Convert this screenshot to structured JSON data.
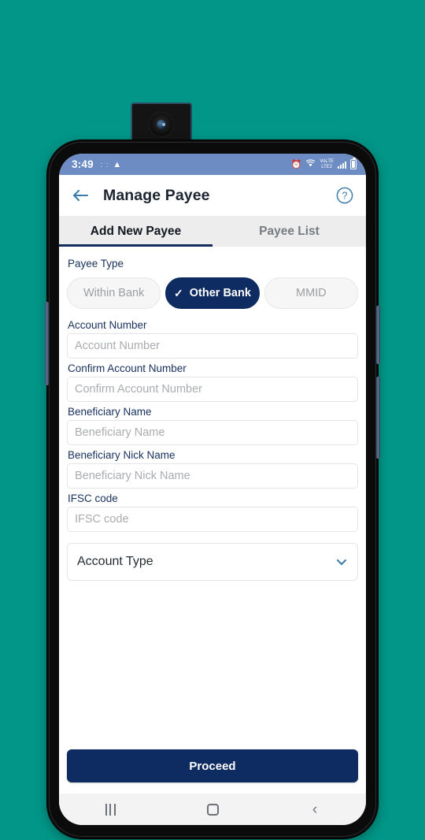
{
  "wallpaper": {
    "color": "#019687"
  },
  "device": {
    "frame_color": "#0b0b0c",
    "popup_camera": "popup-selfie-camera"
  },
  "statusbar": {
    "time": "3:49",
    "dots": ":  :",
    "warning_icon": "warning-triangle-icon",
    "alarm_icon": "alarm-clock-icon",
    "wifi_icon": "wifi-icon",
    "volte_label": "VoLTE",
    "lte_label": "LTE2",
    "signal_icon": "signal-bars-icon",
    "battery_icon": "battery-full-icon",
    "bg_color": "#6d8cc4"
  },
  "appbar": {
    "back_icon": "arrow-left-icon",
    "title": "Manage Payee",
    "help_icon": "help-circle-icon",
    "accent_color": "#3d7ca8"
  },
  "tabs": [
    {
      "label": "Add New Payee",
      "active": true
    },
    {
      "label": "Payee List",
      "active": false
    }
  ],
  "form": {
    "payee_type_label": "Payee Type",
    "payee_type_options": [
      {
        "label": "Within Bank",
        "selected": false
      },
      {
        "label": "Other Bank",
        "selected": true,
        "check_icon": "check-icon"
      },
      {
        "label": "MMID",
        "selected": false
      }
    ],
    "selected_color": "#0e2c61",
    "fields": [
      {
        "label": "Account Number",
        "placeholder": "Account Number",
        "value": ""
      },
      {
        "label": "Confirm Account Number",
        "placeholder": "Confirm Account Number",
        "value": ""
      },
      {
        "label": "Beneficiary Name",
        "placeholder": "Beneficiary Name",
        "value": ""
      },
      {
        "label": "Beneficiary Nick Name",
        "placeholder": "Beneficiary Nick Name",
        "value": ""
      },
      {
        "label": "IFSC code",
        "placeholder": "IFSC code",
        "value": ""
      }
    ],
    "account_type": {
      "selected_label": "Account Type",
      "chevron_icon": "chevron-down-icon"
    }
  },
  "cta": {
    "proceed_label": "Proceed"
  },
  "navbar": {
    "recents_icon": "recents-icon",
    "home_icon": "home-square-icon",
    "back_icon": "back-chevron-icon"
  }
}
